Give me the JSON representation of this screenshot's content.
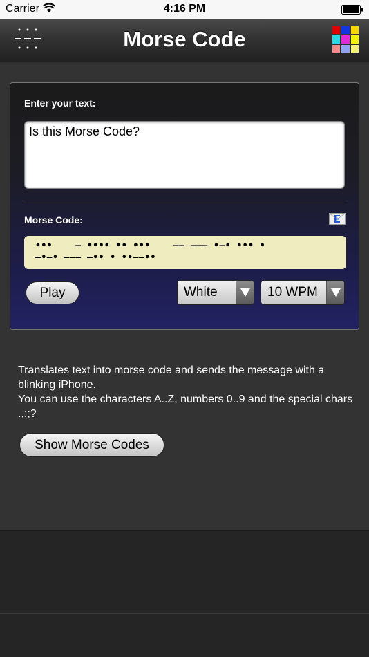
{
  "status_bar": {
    "carrier": "Carrier",
    "time": "4:16 PM"
  },
  "nav": {
    "title": "Morse Code",
    "menu_icon": "dotted-menu-icon",
    "grid_icon": "color-grid-icon",
    "grid_colors": [
      "#e00000",
      "#1436e0",
      "#f6d800",
      "#29d7e6",
      "#e12ad7",
      "#f6f200",
      "#f58a8a",
      "#8fa3f0",
      "#f3f07a"
    ]
  },
  "input": {
    "label": "Enter your text:",
    "value": "Is this Morse Code?"
  },
  "morse": {
    "label": "Morse Code:",
    "mail_icon": "email-icon",
    "output": "•••    ‒ •••• •• •••    ‒‒ ‒‒‒ •‒• ••• •\n‒•‒• ‒‒‒ ‒•• • ••‒‒••"
  },
  "controls": {
    "play_label": "Play",
    "color_value": "White",
    "speed_value": "10 WPM"
  },
  "description": {
    "line1": "Translates text into morse code and sends the message with a blinking iPhone.",
    "line2": "You can use the characters A..Z, numbers 0..9 and the special chars .,:;?"
  },
  "show_button_label": "Show Morse Codes",
  "colors": {
    "accent_panel_bottom": "#222263",
    "morse_box_bg": "#efedc0"
  }
}
